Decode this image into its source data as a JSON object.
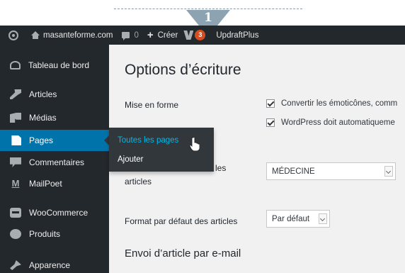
{
  "callout": {
    "number": "1"
  },
  "admin_bar": {
    "site_name": "masanteforme.com",
    "comments_count": "0",
    "create_label": "Créer",
    "notifications_count": "3",
    "plugin_label": "UpdraftPlus"
  },
  "sidebar": {
    "items": [
      {
        "label": "Tableau de bord",
        "icon": "dashboard-icon"
      },
      {
        "label": "Articles",
        "icon": "pin-icon"
      },
      {
        "label": "Médias",
        "icon": "media-icon"
      },
      {
        "label": "Pages",
        "icon": "pages-icon",
        "active": true
      },
      {
        "label": "Commentaires",
        "icon": "comments-icon"
      },
      {
        "label": "MailPoet",
        "icon": "mailpoet-icon"
      },
      {
        "label": "WooCommerce",
        "icon": "woocommerce-icon"
      },
      {
        "label": "Produits",
        "icon": "products-icon"
      },
      {
        "label": "Apparence",
        "icon": "appearance-icon"
      }
    ]
  },
  "flyout": {
    "items": [
      "Toutes les pages",
      "Ajouter"
    ]
  },
  "main": {
    "title": "Options d’écriture",
    "formatting_label": "Mise en forme",
    "checkbox_1": "Convertir les émoticônes, comm",
    "checkbox_2": "WordPress doit automatiqueme",
    "category_label_tail": "les",
    "category_label_line2": "articles",
    "category_value": "MÉDECINE",
    "format_label": "Format par défaut des articles",
    "format_value": "Par défaut",
    "email_heading": "Envoi d’article par e-mail"
  },
  "colors": {
    "admin_bar": "#23282d",
    "active_menu": "#0073aa",
    "flyout_current": "#00b9eb",
    "notification": "#d54e21",
    "content_bg": "#f1f1f1"
  }
}
